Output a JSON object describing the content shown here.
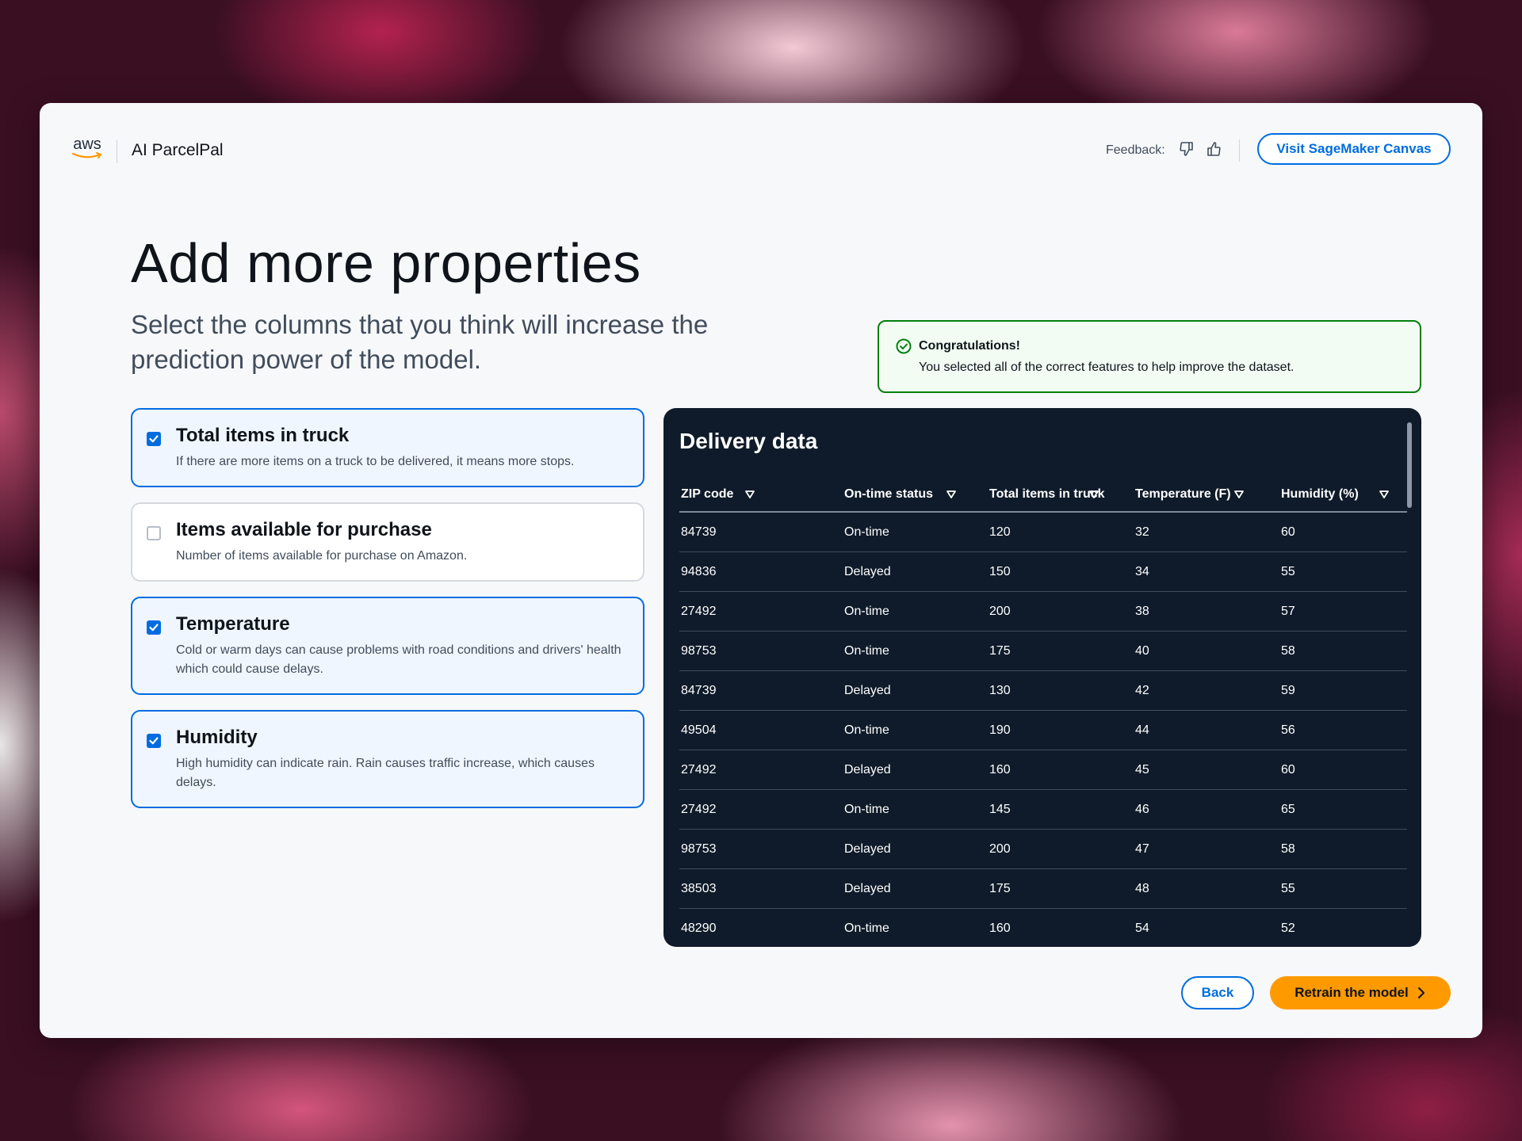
{
  "header": {
    "logo_text": "aws",
    "app_name": "AI ParcelPal",
    "feedback_label": "Feedback:",
    "visit_button": "Visit SageMaker Canvas"
  },
  "main": {
    "title": "Add more properties",
    "subtitle": "Select the columns that you think will increase the prediction power of the model."
  },
  "alert": {
    "title": "Congratulations!",
    "body": "You selected all of the correct features to help improve the dataset.",
    "color": "#037f0c"
  },
  "features": [
    {
      "title": "Total items in truck",
      "description": "If there are more items on a truck to be delivered, it means more stops.",
      "checked": true
    },
    {
      "title": "Items available for purchase",
      "description": "Number of items available for purchase on Amazon.",
      "checked": false
    },
    {
      "title": "Temperature",
      "description": "Cold or warm days can cause problems with road conditions and drivers' health which could cause delays.",
      "checked": true
    },
    {
      "title": "Humidity",
      "description": "High humidity can indicate rain. Rain causes traffic increase, which causes delays.",
      "checked": true
    }
  ],
  "table": {
    "title": "Delivery data",
    "columns": [
      "ZIP code",
      "On-time status",
      "Total items in truck",
      "Temperature (F)",
      "Humidity (%)"
    ],
    "rows": [
      [
        "84739",
        "On-time",
        "120",
        "32",
        "60"
      ],
      [
        "94836",
        "Delayed",
        "150",
        "34",
        "55"
      ],
      [
        "27492",
        "On-time",
        "200",
        "38",
        "57"
      ],
      [
        "98753",
        "On-time",
        "175",
        "40",
        "58"
      ],
      [
        "84739",
        "Delayed",
        "130",
        "42",
        "59"
      ],
      [
        "49504",
        "On-time",
        "190",
        "44",
        "56"
      ],
      [
        "27492",
        "Delayed",
        "160",
        "45",
        "60"
      ],
      [
        "27492",
        "On-time",
        "145",
        "46",
        "65"
      ],
      [
        "98753",
        "Delayed",
        "200",
        "47",
        "58"
      ],
      [
        "38503",
        "Delayed",
        "175",
        "48",
        "55"
      ],
      [
        "48290",
        "On-time",
        "160",
        "54",
        "52"
      ]
    ]
  },
  "footer": {
    "back_label": "Back",
    "retrain_label": "Retrain the model"
  },
  "colors": {
    "accent": "#006ce0",
    "primary_button": "#ff9900",
    "table_background": "#0f1b2a"
  }
}
